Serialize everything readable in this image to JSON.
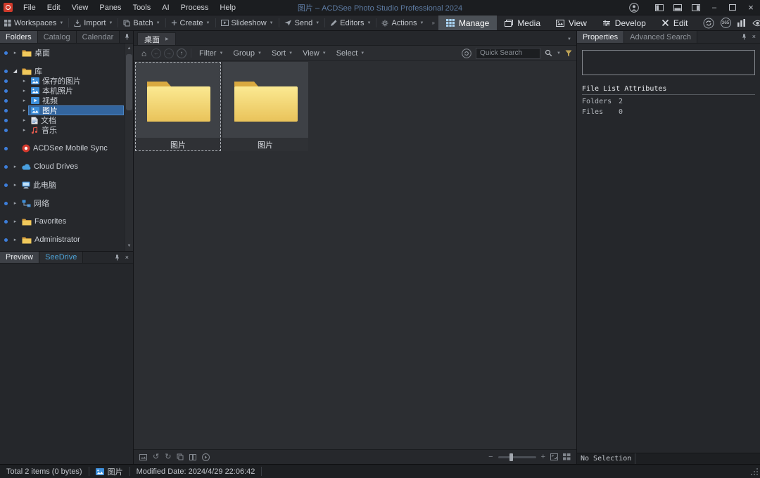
{
  "window": {
    "title": "图片 – ACDSee Photo Studio Professional 2024"
  },
  "menu_bar": {
    "items": [
      "File",
      "Edit",
      "View",
      "Panes",
      "Tools",
      "AI",
      "Process",
      "Help"
    ]
  },
  "toolbar": {
    "buttons": [
      {
        "label": "Workspaces",
        "icon": "workspaces-icon"
      },
      {
        "label": "Import",
        "icon": "import-icon"
      },
      {
        "label": "Batch",
        "icon": "batch-icon"
      },
      {
        "label": "Create",
        "icon": "create-icon"
      },
      {
        "label": "Slideshow",
        "icon": "slideshow-icon"
      },
      {
        "label": "Send",
        "icon": "send-icon"
      },
      {
        "label": "Editors",
        "icon": "editors-icon"
      },
      {
        "label": "Actions",
        "icon": "actions-icon"
      }
    ],
    "modes": [
      {
        "label": "Manage",
        "icon": "manage-icon",
        "active": true
      },
      {
        "label": "Media",
        "icon": "media-icon",
        "active": false
      },
      {
        "label": "View",
        "icon": "view-icon",
        "active": false
      },
      {
        "label": "Develop",
        "icon": "develop-icon",
        "active": false
      },
      {
        "label": "Edit",
        "icon": "edit-icon",
        "active": false
      }
    ],
    "right_icons": [
      "sync-icon",
      "acdsee-365-icon",
      "stats-icon",
      "eye-icon"
    ],
    "acdsee_365_label": "365"
  },
  "folders_panel": {
    "tabs": [
      {
        "label": "Folders",
        "active": true
      },
      {
        "label": "Catalog",
        "active": false
      },
      {
        "label": "Calendar",
        "active": false
      }
    ],
    "tree": [
      {
        "label": "桌面",
        "icon": "folder-icon",
        "depth": 0,
        "arrow": "collapsed",
        "group": true
      },
      {
        "label": "库",
        "icon": "folder-icon",
        "depth": 0,
        "arrow": "expanded",
        "group": true
      },
      {
        "label": "保存的图片",
        "icon": "pictures-icon",
        "depth": 1,
        "arrow": "collapsed"
      },
      {
        "label": "本机照片",
        "icon": "pictures-icon",
        "depth": 1,
        "arrow": "collapsed"
      },
      {
        "label": "视频",
        "icon": "video-icon",
        "depth": 1,
        "arrow": "collapsed"
      },
      {
        "label": "图片",
        "icon": "pictures-icon",
        "depth": 1,
        "arrow": "collapsed",
        "selected": true
      },
      {
        "label": "文档",
        "icon": "document-icon",
        "depth": 1,
        "arrow": "collapsed"
      },
      {
        "label": "音乐",
        "icon": "music-icon",
        "depth": 1,
        "arrow": "collapsed"
      },
      {
        "label": "ACDSee Mobile Sync",
        "icon": "acdsee-icon",
        "depth": 0,
        "arrow": "none",
        "group": true
      },
      {
        "label": "Cloud Drives",
        "icon": "cloud-icon",
        "depth": 0,
        "arrow": "collapsed",
        "group": true
      },
      {
        "label": "此电脑",
        "icon": "computer-icon",
        "depth": 0,
        "arrow": "collapsed",
        "group": true
      },
      {
        "label": "网络",
        "icon": "network-icon",
        "depth": 0,
        "arrow": "collapsed",
        "group": true
      },
      {
        "label": "Favorites",
        "icon": "folder-icon",
        "depth": 0,
        "arrow": "collapsed",
        "group": true
      },
      {
        "label": "Administrator",
        "icon": "folder-icon",
        "depth": 0,
        "arrow": "collapsed",
        "group": true
      }
    ]
  },
  "preview_panel": {
    "tabs": [
      {
        "label": "Preview",
        "active": true
      },
      {
        "label": "SeeDrive",
        "active": false,
        "accent": true
      }
    ]
  },
  "browser": {
    "path_tab": "桌面",
    "nav_icons": [
      "home-icon",
      "back-icon",
      "forward-icon",
      "up-icon"
    ],
    "menus": [
      "Filter",
      "Group",
      "Sort",
      "View",
      "Select"
    ],
    "search": {
      "placeholder": "Quick Search"
    },
    "files": [
      {
        "name": "图片",
        "type": "folder",
        "selected": true
      },
      {
        "name": "图片",
        "type": "folder",
        "selected": false
      }
    ],
    "footer_icons": [
      "image-basket-icon",
      "rotate-left-icon",
      "rotate-right-icon",
      "copy-icon",
      "compare-icon",
      "auto-advance-icon"
    ],
    "zoom_icons_left": "zoom-out-icon",
    "zoom_icons_right": [
      "zoom-in-icon",
      "fit-image-icon",
      "thumbnail-size-icon"
    ]
  },
  "properties_panel": {
    "tabs": [
      {
        "label": "Properties",
        "active": true
      },
      {
        "label": "Advanced Search",
        "active": false
      }
    ],
    "section_title": "File List Attributes",
    "attributes": [
      {
        "key": "Folders",
        "value": "2"
      },
      {
        "key": "Files",
        "value": "0"
      }
    ],
    "footer": "No Selection"
  },
  "status_bar": {
    "total": "Total 2 items  (0 bytes)",
    "item_name": "图片",
    "modified": "Modified Date: 2024/4/29 22:06:42"
  }
}
